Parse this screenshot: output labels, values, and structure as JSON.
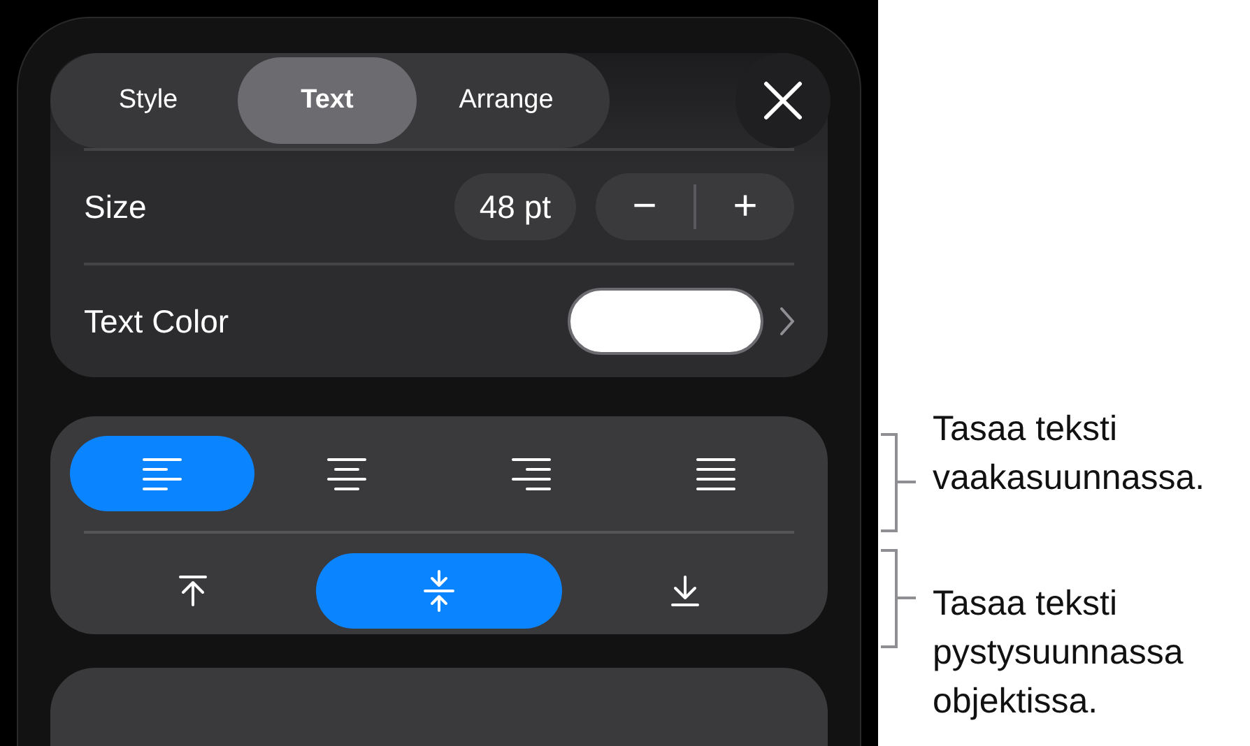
{
  "tabs": [
    {
      "label": "Style",
      "selected": false
    },
    {
      "label": "Text",
      "selected": true
    },
    {
      "label": "Arrange",
      "selected": false
    }
  ],
  "size": {
    "label": "Size",
    "value": "48 pt",
    "decrement": "−",
    "increment": "+"
  },
  "text_color": {
    "label": "Text Color"
  },
  "horizontal_alignment": [
    {
      "kind": "left",
      "selected": true
    },
    {
      "kind": "center",
      "selected": false
    },
    {
      "kind": "right",
      "selected": false
    },
    {
      "kind": "justify",
      "selected": false
    }
  ],
  "vertical_alignment": [
    {
      "kind": "top",
      "selected": false
    },
    {
      "kind": "middle",
      "selected": true
    },
    {
      "kind": "bottom",
      "selected": false
    }
  ],
  "callouts": [
    {
      "text": "Tasaa teksti vaakasuunnassa."
    },
    {
      "text": "Tasaa teksti pystysuunnassa objektissa."
    }
  ]
}
